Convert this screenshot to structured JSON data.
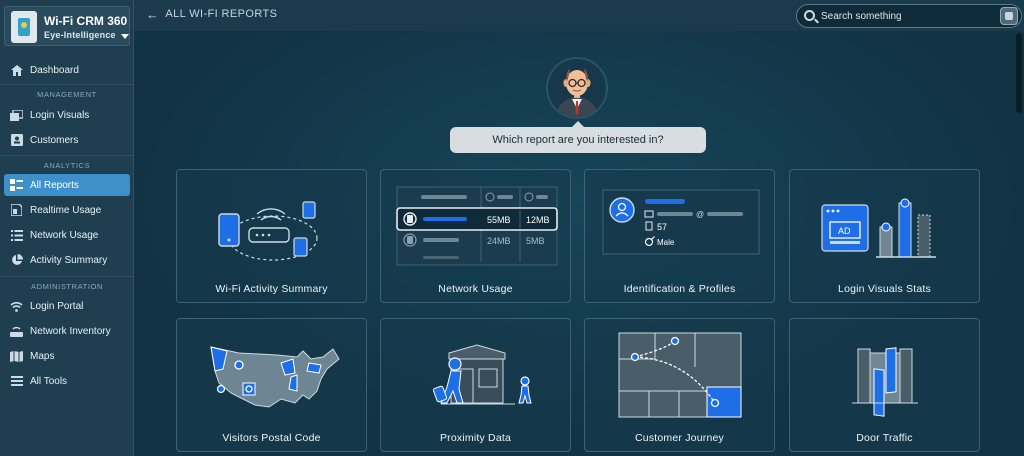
{
  "brand": {
    "title": "Wi-Fi CRM 360",
    "org": "Eye-Intelligence"
  },
  "nav": {
    "dashboard": "Dashboard",
    "section_management": "MANAGEMENT",
    "login_visuals": "Login Visuals",
    "customers": "Customers",
    "section_analytics": "ANALYTICS",
    "all_reports": "All Reports",
    "realtime_usage": "Realtime Usage",
    "network_usage": "Network Usage",
    "activity_summary": "Activity Summary",
    "section_administration": "ADMINISTRATION",
    "login_portal": "Login Portal",
    "network_inventory": "Network Inventory",
    "maps": "Maps",
    "all_tools": "All Tools"
  },
  "header": {
    "back_label": "ALL WI-FI REPORTS",
    "search_placeholder": "Search something"
  },
  "prompt": "Which report are you interested in?",
  "cards": {
    "wifi_activity": "Wi-Fi Activity Summary",
    "network_usage": "Network Usage",
    "identification": "Identification & Profiles",
    "login_stats": "Login Visuals Stats",
    "postal": "Visitors Postal Code",
    "proximity": "Proximity Data",
    "journey": "Customer Journey",
    "door": "Door Traffic"
  },
  "network_usage_illustration": {
    "row1": {
      "download": "55MB",
      "upload": "12MB"
    },
    "row2": {
      "download": "24MB",
      "upload": "5MB"
    }
  },
  "profile_illustration": {
    "at": "@",
    "count": "57",
    "gender": "Male"
  },
  "ad_label": "AD",
  "colors": {
    "accent": "#1e6ee8",
    "sidebar": "#1f3f51",
    "background": "#123344",
    "active": "#3d90c9"
  }
}
